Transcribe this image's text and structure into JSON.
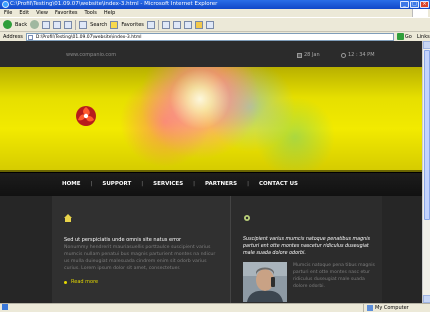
{
  "browser": {
    "title": "C:\\Profil\\Testing\\01.09.07\\website\\index-3.html - Microsoft Internet Explorer",
    "menu": [
      "File",
      "Edit",
      "View",
      "Favorites",
      "Tools",
      "Help"
    ],
    "toolbar": {
      "back": "Back",
      "search": "Search",
      "favorites": "Favorites"
    },
    "address_label": "Address",
    "address_value": "D:\\Profil\\Testing\\01.09.07\\website\\index-3.html",
    "go": "Go",
    "links": "Links",
    "status_zone": "My Computer"
  },
  "site": {
    "url": "www.companio.com",
    "date": "28 Jan",
    "time": "12 : 34 PM",
    "nav": [
      "HOME",
      "SUPPORT",
      "SERVICES",
      "PARTNERS",
      "CONTACT US"
    ],
    "left": {
      "lead": "Sed ut perspiciatis unde omnis site natus error",
      "body": "Nonummy hendrerit mauriasuellis porttaulce suscipient varius mumcis nullam penatui bus magnis parturient montes na ndicur us mulla duieugiat malesuada cindrem enim sit odorb varius curius. Lorem ipsum dolor sit amet, consectetuer.",
      "readmore": "Read more"
    },
    "right": {
      "lead": "Suscipient varius mumcis natoque penatibus magnis parturi ent otte montes nascetur ridiculus duseugiat male suada dolore odorbi.",
      "body": "Mumcis natoque pena tibus magnis parturi ent otte montes nasc etur ridiculus duseugiat male suada dolore odorbi."
    }
  }
}
